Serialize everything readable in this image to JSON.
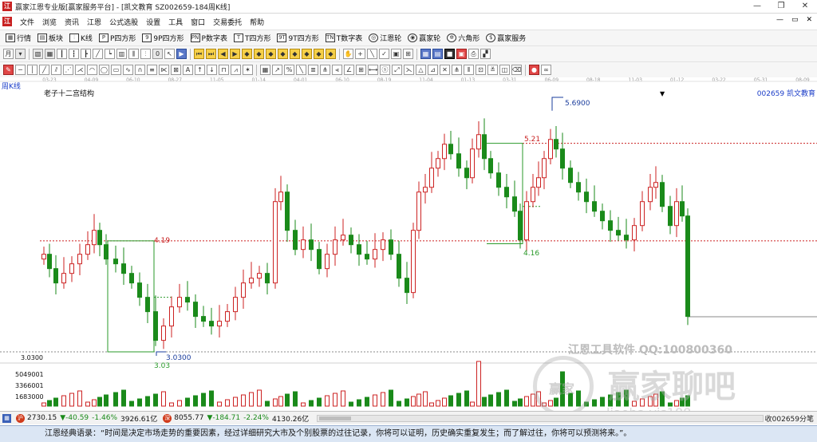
{
  "window": {
    "title": "赢家江恩专业版[赢家服务平台] - [凯文教育 SZ002659-184周K线]",
    "controls": [
      "—",
      "❐",
      "✕"
    ]
  },
  "menubar": {
    "items": [
      "文件",
      "浏览",
      "资讯",
      "江恩",
      "公式选股",
      "设置",
      "工具",
      "窗口",
      "交易委托",
      "帮助"
    ],
    "mdi_controls": [
      "—",
      "▭",
      "✕"
    ]
  },
  "toolbar1": {
    "buttons": [
      {
        "icon": "quote-grid-icon",
        "glyph": "▦",
        "label": "行情"
      },
      {
        "icon": "sector-icon",
        "glyph": "▤",
        "label": "板块"
      },
      {
        "icon": "kline-icon",
        "glyph": "⫶",
        "label": "K线"
      },
      {
        "icon": "p-square-icon",
        "glyph": "P",
        "label": "P四方形"
      },
      {
        "icon": "nine-square-icon",
        "glyph": "9",
        "label": "9P四方形"
      },
      {
        "icon": "pn-square-icon",
        "glyph": "PN",
        "label": "P数字表"
      },
      {
        "icon": "t-square-icon",
        "glyph": "T",
        "label": "T四方形"
      },
      {
        "icon": "nine-t-square-icon",
        "glyph": "9T",
        "label": "9T四方形"
      },
      {
        "icon": "tn-table-icon",
        "glyph": "TN",
        "label": "T数字表"
      },
      {
        "icon": "gann-wheel-icon",
        "glyph": "◎",
        "label": "江恩轮"
      },
      {
        "icon": "winner-wheel-icon",
        "glyph": "◉",
        "label": "赢家轮"
      },
      {
        "icon": "hexagon-icon",
        "glyph": "✲",
        "label": "六角形"
      },
      {
        "icon": "winner-service-icon",
        "glyph": "$",
        "label": "赢家服务"
      }
    ]
  },
  "period_label": "周K线",
  "indicator_name": "老子十二宫结构",
  "stock_label": "002659 凯文教育",
  "date_ticks": [
    "03-23",
    "04-09",
    "06-10",
    "08-27",
    "11-05",
    "01-14",
    "04-01",
    "06-10",
    "08-19",
    "11-04",
    "01-13",
    "03-31",
    "06-09",
    "08-18",
    "11-03",
    "01-12",
    "03-22",
    "05-31",
    "08-09"
  ],
  "annotations": {
    "level_419": "4.19",
    "level_521": "5.21",
    "level_416": "4.16",
    "level_303": "3.03",
    "high_5690": "5.6900",
    "low_30300": "3.0300",
    "axis_low": "3.0300"
  },
  "volume_axis": [
    "5049001",
    "3366001",
    "1683000"
  ],
  "watermark": {
    "brand": "江恩工具软件  QQ:100800360",
    "logo_text": "赢家",
    "forum": "赢家聊吧",
    "url": "liaoba.yjs188"
  },
  "statusbar": {
    "index1": {
      "name": "沪",
      "price": "2730.15",
      "change": "▼-40.59",
      "pct": "-1.46%",
      "amount": "3926.61亿"
    },
    "index2": {
      "name": "深",
      "price": "8055.77",
      "change": "▼-184.71",
      "pct": "-2.24%",
      "amount": "4130.26亿"
    },
    "message": "收002659分笔"
  },
  "quote": "江恩经典语录：“时间是决定市场走势的重要因素，经过详细研究大市及个别股票的过往记录，你将可以证明，历史确实重复发生；而了解过往，你将可以预测将来。”。",
  "colors": {
    "up": "#cc2222",
    "down": "#1a8a1a",
    "level": "#cc2222",
    "box_green": "#2a9a2a",
    "accent_blue": "#1a3cc8"
  },
  "chart_data": {
    "type": "candlestick",
    "title": "老子十二宫结构",
    "period": "周K线",
    "symbol": "002659",
    "name": "凯文教育",
    "price_levels": [
      4.19,
      5.21
    ],
    "box_lows": [
      3.03,
      4.16
    ],
    "labeled_high": 5.69,
    "labeled_low": 3.03,
    "volume_axis_ticks": [
      1683000,
      3366001,
      5049001
    ]
  }
}
